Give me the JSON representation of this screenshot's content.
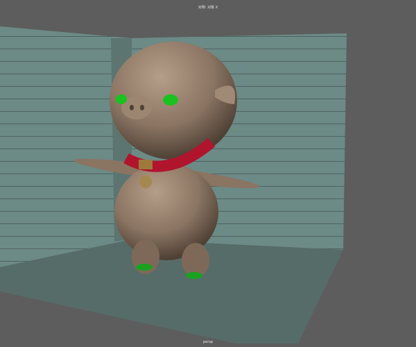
{
  "viewport": {
    "symmetry_label": "对称: 对象 X",
    "camera_label": "persp"
  },
  "colors": {
    "background": "#5d5d5d",
    "walls": "#6c8a86",
    "floor": "#556b67",
    "character": "#8a7462",
    "eyes": "#19c21f",
    "collar": "#b0152d"
  }
}
